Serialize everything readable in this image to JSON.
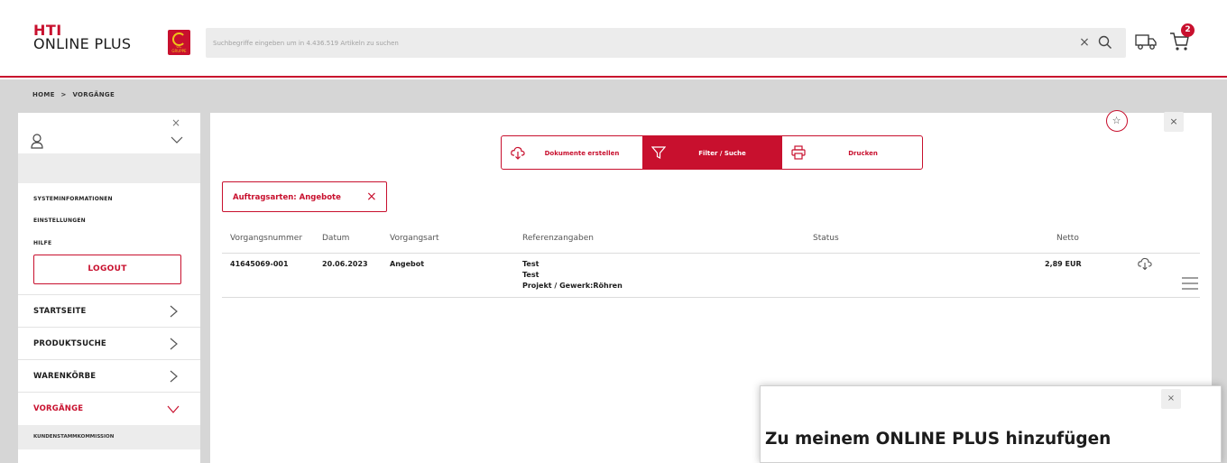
{
  "header": {
    "logo_line1": "HTI",
    "logo_line2": "ONLINE PLUS",
    "group_badge": "GC GRUPPE",
    "search_placeholder": "Suchbegriffe eingeben um in 4.436.519 Artikeln zu suchen",
    "clear_symbol": "×",
    "cart_count": "2",
    "brand_color": "#c8102e"
  },
  "breadcrumb": {
    "home": "HOME",
    "sep": ">",
    "current": "VORGÄNGE"
  },
  "sidebar": {
    "close": "×",
    "links": {
      "system": "SYSTEMINFORMATIONEN",
      "settings": "EINSTELLUNGEN",
      "help": "HILFE"
    },
    "logout": "LOGOUT",
    "nav": [
      {
        "label": "STARTSEITE"
      },
      {
        "label": "PRODUKTSUCHE"
      },
      {
        "label": "WARENKÖRBE"
      },
      {
        "label": "VORGÄNGE"
      }
    ],
    "sub_item": "KUNDENSTAMMKOMMISSION"
  },
  "main": {
    "close": "×",
    "tabs": {
      "documents": "Dokumente erstellen",
      "filter": "Filter / Suche",
      "print": "Drucken"
    },
    "filter_chip": "Auftragsarten: Angebote",
    "filter_chip_remove": "×",
    "table": {
      "headers": {
        "number": "Vorgangsnummer",
        "date": "Datum",
        "type": "Vorgangsart",
        "reference": "Referenzangaben",
        "status": "Status",
        "net": "Netto"
      },
      "rows": [
        {
          "number": "41645069-001",
          "date": "20.06.2023",
          "type": "Angebot",
          "ref1": "Test",
          "ref2": "Test",
          "ref3": "Projekt / Gewerk:Röhren",
          "status": "",
          "net": "2,89 EUR"
        }
      ]
    }
  },
  "popup": {
    "close": "×",
    "title": "Zu meinem ONLINE PLUS hinzufügen"
  }
}
